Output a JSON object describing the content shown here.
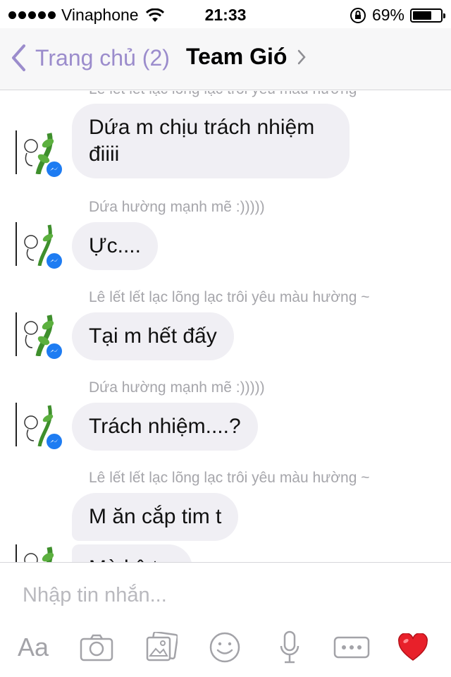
{
  "status_bar": {
    "carrier": "Vinaphone",
    "time": "21:33",
    "battery_percent_label": "69%",
    "battery_level": 0.69
  },
  "nav": {
    "back_label": "Trang chủ (2)",
    "title": "Team Gió"
  },
  "messages": [
    {
      "sender": "Lê lết lết lạc lõng lạc trôi yêu màu hường ~",
      "text": "Dứa m chịu trách nhiệm điiii"
    },
    {
      "sender": "Dứa hường mạnh mẽ  :)))))",
      "text": "Ực...."
    },
    {
      "sender": "Lê lết lết lạc lõng lạc trôi yêu màu hường ~",
      "text": "Tại m hết đấy"
    },
    {
      "sender": "Dứa hường mạnh mẽ  :)))))",
      "text": "Trách nhiệm....?"
    },
    {
      "sender": "Lê lết lết lạc lõng lạc trôi yêu màu hường ~",
      "text": "M ăn cắp tim t"
    },
    {
      "sender": "",
      "text": "Mà kệ t..."
    }
  ],
  "composer": {
    "placeholder": "Nhập tin nhắn...",
    "text_tool_label": "Aa"
  },
  "icons": {
    "camera": "camera-icon",
    "gallery": "gallery-icon",
    "emoji": "emoji-icon",
    "mic": "microphone-icon",
    "more": "more-icon",
    "like": "heart-icon"
  },
  "colors": {
    "accent": "#9b8ccc",
    "bubble": "#f0eff4",
    "messenger_badge": "#1e7cf2",
    "heart": "#e8202a"
  }
}
